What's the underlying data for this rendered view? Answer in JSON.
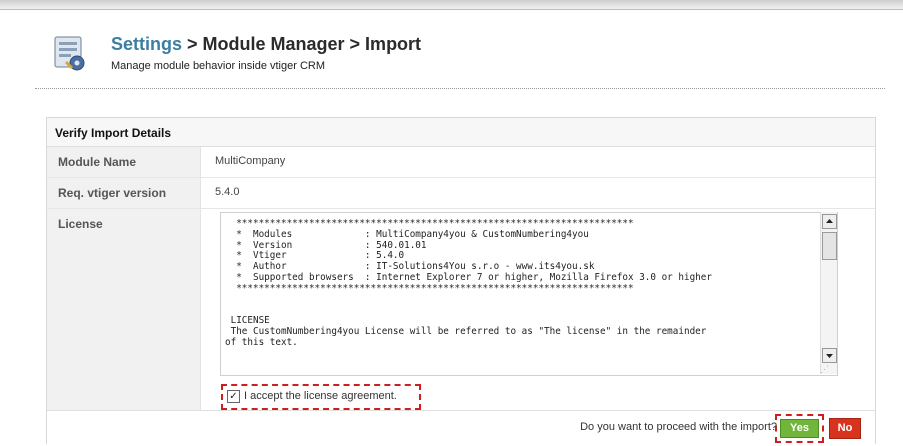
{
  "header": {
    "crumb_settings": "Settings",
    "crumb_rest": " > Module Manager > Import",
    "subtitle": "Manage module behavior inside vtiger CRM"
  },
  "panel": {
    "title": "Verify Import Details",
    "module_name_label": "Module Name",
    "module_name_value": "MultiCompany",
    "version_label": "Req. vtiger version",
    "version_value": "5.4.0",
    "license_label": "License",
    "license_text": "  ***********************************************************************\n  *  Modules             : MultiCompany4you & CustomNumbering4you\n  *  Version             : 540.01.01\n  *  Vtiger              : 5.4.0\n  *  Author              : IT-Solutions4You s.r.o - www.its4you.sk\n  *  Supported browsers  : Internet Explorer 7 or higher, Mozilla Firefox 3.0 or higher\n  ***********************************************************************\n\n\n LICENSE\n The CustomNumbering4you License will be referred to as \"The license\" in the remainder\nof this text.",
    "accept_label": "I accept the license agreement.",
    "accept_checked": true
  },
  "footer": {
    "question": "Do you want to proceed with the import?",
    "yes_label": "Yes",
    "no_label": "No"
  },
  "colors": {
    "accent_link": "#3a7ea4",
    "yes_button": "#6fb63a",
    "no_button": "#d8331e",
    "highlight_dash": "#cc1f1f"
  }
}
